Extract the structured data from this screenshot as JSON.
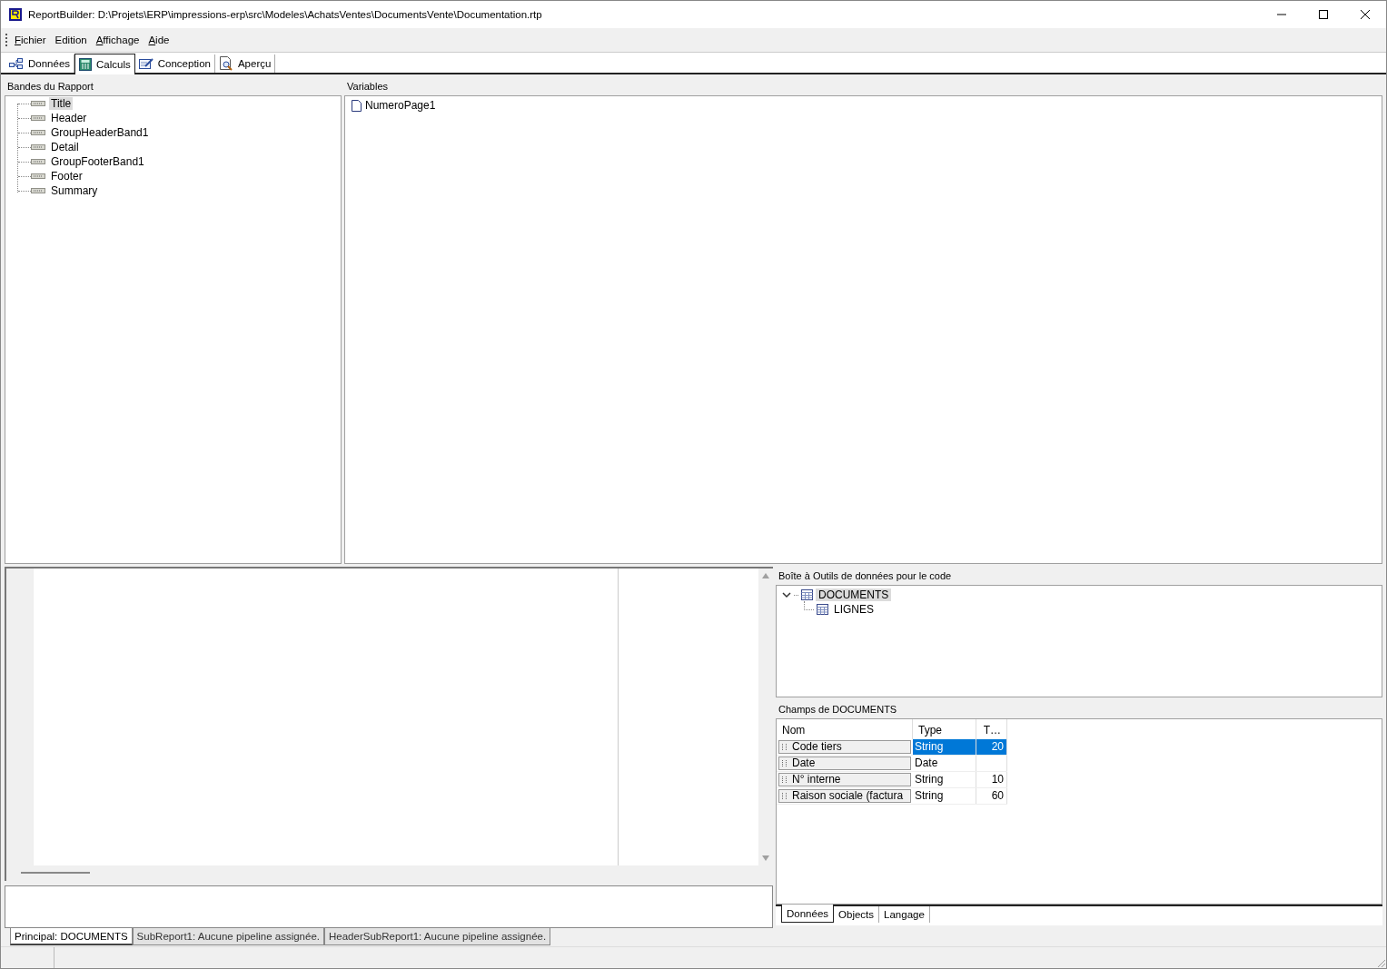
{
  "window": {
    "title": "ReportBuilder: D:\\Projets\\ERP\\impressions-erp\\src\\Modeles\\AchatsVentes\\DocumentsVente\\Documentation.rtp"
  },
  "menu": [
    {
      "label": "Fichier",
      "mnemonic": true
    },
    {
      "label": "Edition",
      "mnemonic": false
    },
    {
      "label": "Affichage",
      "mnemonic": true
    },
    {
      "label": "Aide",
      "mnemonic": true
    }
  ],
  "tabs": [
    {
      "label": "Données",
      "kind": "data",
      "selected": false
    },
    {
      "label": "Calculs",
      "kind": "calc",
      "selected": true
    },
    {
      "label": "Conception",
      "kind": "design",
      "selected": false
    },
    {
      "label": "Aperçu",
      "kind": "preview",
      "selected": false
    }
  ],
  "bands": {
    "title": "Bandes du Rapport",
    "items": [
      {
        "label": "Title",
        "selected": true
      },
      {
        "label": "Header",
        "selected": false
      },
      {
        "label": "GroupHeaderBand1",
        "selected": false
      },
      {
        "label": "Detail",
        "selected": false
      },
      {
        "label": "GroupFooterBand1",
        "selected": false
      },
      {
        "label": "Footer",
        "selected": false
      },
      {
        "label": "Summary",
        "selected": false
      }
    ]
  },
  "variables": {
    "title": "Variables",
    "items": [
      {
        "label": "NumeroPage1"
      }
    ]
  },
  "toolbox": {
    "title": "Boîte à Outils de données pour le code",
    "tree": [
      {
        "label": "DOCUMENTS",
        "selected": true,
        "expanded": true,
        "children": [
          {
            "label": "LIGNES",
            "selected": false
          }
        ]
      }
    ]
  },
  "fields": {
    "title": "Champs de DOCUMENTS",
    "columns": [
      "Nom",
      "Type",
      "T…"
    ],
    "rows": [
      {
        "cells": [
          "Code tiers",
          "String",
          "20"
        ],
        "selected": true
      },
      {
        "cells": [
          "Date",
          "Date",
          ""
        ],
        "selected": false
      },
      {
        "cells": [
          "N° interne",
          "String",
          "10"
        ],
        "selected": false
      },
      {
        "cells": [
          "Raison sociale (factura",
          "String",
          "60"
        ],
        "selected": false
      }
    ]
  },
  "side_tabs": [
    {
      "label": "Données",
      "selected": true
    },
    {
      "label": "Objects",
      "selected": false
    },
    {
      "label": "Langage",
      "selected": false
    }
  ],
  "report_tabs": [
    {
      "label": "Principal: DOCUMENTS",
      "selected": true
    },
    {
      "label": "SubReport1: Aucune pipeline assignée.",
      "selected": false
    },
    {
      "label": "HeaderSubReport1: Aucune pipeline assignée.",
      "selected": false
    }
  ]
}
